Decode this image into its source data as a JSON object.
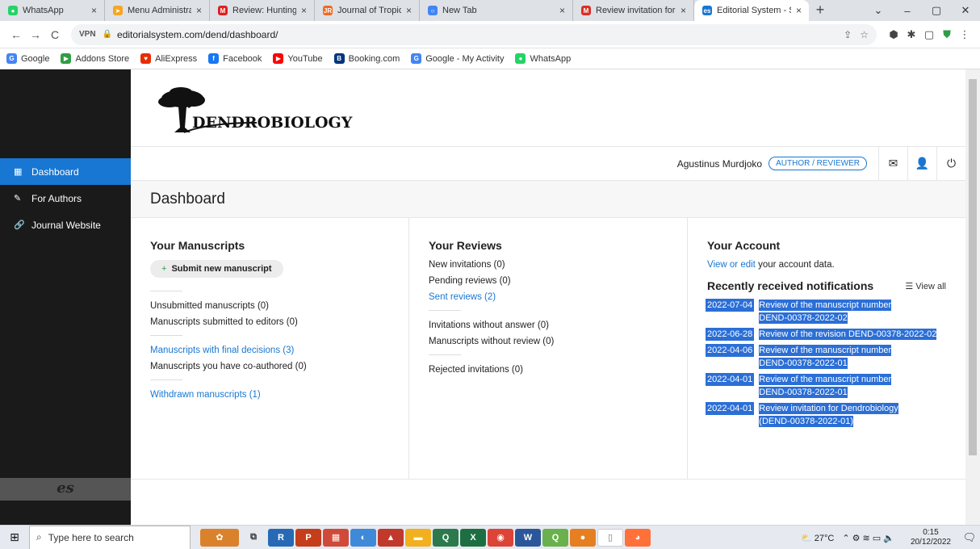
{
  "browser": {
    "tabs": [
      {
        "label": "WhatsApp",
        "color": "#25d366",
        "glyph": "●",
        "active": false
      },
      {
        "label": "Menu Administrasi Sc",
        "color": "#f5a623",
        "glyph": "➤",
        "active": false
      },
      {
        "label": "Review: Hunting of w",
        "color": "#e02020",
        "glyph": "M",
        "active": false
      },
      {
        "label": "Journal of Tropical Ec",
        "color": "#f06a1f",
        "glyph": "JR",
        "active": false
      },
      {
        "label": "New Tab",
        "color": "#4285f4",
        "glyph": "○",
        "active": false
      },
      {
        "label": "Review invitation for",
        "color": "#d93025",
        "glyph": "M",
        "active": false
      },
      {
        "label": "Editorial System - Sci",
        "color": "#1877d2",
        "glyph": "es",
        "active": true
      }
    ],
    "new_tab": "+",
    "window_controls": {
      "chevron": "⌄",
      "minimize": "–",
      "maximize": "▢",
      "close": "✕"
    },
    "nav": {
      "back": "←",
      "forward": "→",
      "reload": "C"
    },
    "vpn_label": "VPN",
    "lock_glyph": "🔒",
    "url": "editorialsystem.com/dend/dashboard/",
    "bookmarks": [
      {
        "label": "Google",
        "color": "#4285f4",
        "glyph": "G"
      },
      {
        "label": "Addons Store",
        "color": "#2e9e44",
        "glyph": "▶"
      },
      {
        "label": "AliExpress",
        "color": "#e62e04",
        "glyph": "♥"
      },
      {
        "label": "Facebook",
        "color": "#1877f2",
        "glyph": "f"
      },
      {
        "label": "YouTube",
        "color": "#ff0000",
        "glyph": "▶"
      },
      {
        "label": "Booking.com",
        "color": "#003580",
        "glyph": "B"
      },
      {
        "label": "Google - My Activity",
        "color": "#4285f4",
        "glyph": "G"
      },
      {
        "label": "WhatsApp",
        "color": "#25d366",
        "glyph": "●"
      }
    ]
  },
  "sidebar": {
    "items": [
      {
        "label": "Dashboard",
        "icon": "grid-icon",
        "glyph": "▦",
        "active": true
      },
      {
        "label": "For Authors",
        "icon": "pencil-icon",
        "glyph": "✎",
        "active": false
      },
      {
        "label": "Journal Website",
        "icon": "link-icon",
        "glyph": "🔗",
        "active": false
      }
    ],
    "brand": "es"
  },
  "header": {
    "logo_text": "DENDROBIOLOGY",
    "user_name": "Agustinus Murdjoko",
    "role": "AUTHOR / REVIEWER"
  },
  "page_title": "Dashboard",
  "manuscripts": {
    "title": "Your Manuscripts",
    "submit_label": "Submit new manuscript",
    "unsubmitted": "Unsubmitted manuscripts (0)",
    "submitted": "Manuscripts submitted to editors (0)",
    "final_decisions": "Manuscripts with final decisions",
    "final_count": "(3)",
    "coauthored": "Manuscripts you have co-authored (0)",
    "withdrawn": "Withdrawn manuscripts (1)"
  },
  "reviews": {
    "title": "Your Reviews",
    "new_invitations": "New invitations (0)",
    "pending": "Pending reviews (0)",
    "sent": "Sent reviews (2)",
    "without_answer": "Invitations without answer (0)",
    "without_review": "Manuscripts without review (0)",
    "rejected": "Rejected invitations (0)"
  },
  "account": {
    "title": "Your Account",
    "edit_link": "View or edit",
    "edit_rest": " your account data.",
    "notif_title": "Recently received notifications",
    "view_all": "View all",
    "notifications": [
      {
        "date": "2022-07-04",
        "line1": "Review of the manuscript number",
        "line2": "DEND-00378-2022-02"
      },
      {
        "date": "2022-06-28",
        "line1": "Review of the revision DEND-00378-2022-02",
        "line2": ""
      },
      {
        "date": "2022-04-06",
        "line1": "Review of the manuscript number",
        "line2": "DEND-00378-2022-01"
      },
      {
        "date": "2022-04-01",
        "line1": "Review of the manuscript number",
        "line2": "DEND-00378-2022-01"
      },
      {
        "date": "2022-04-01",
        "line1": "Review invitation for Dendrobiology",
        "line2": "(DEND-00378-2022-01)"
      }
    ]
  },
  "taskbar": {
    "search_placeholder": "Type here to search",
    "temperature": "27°C",
    "time": "0:15",
    "date": "20/12/2022"
  }
}
